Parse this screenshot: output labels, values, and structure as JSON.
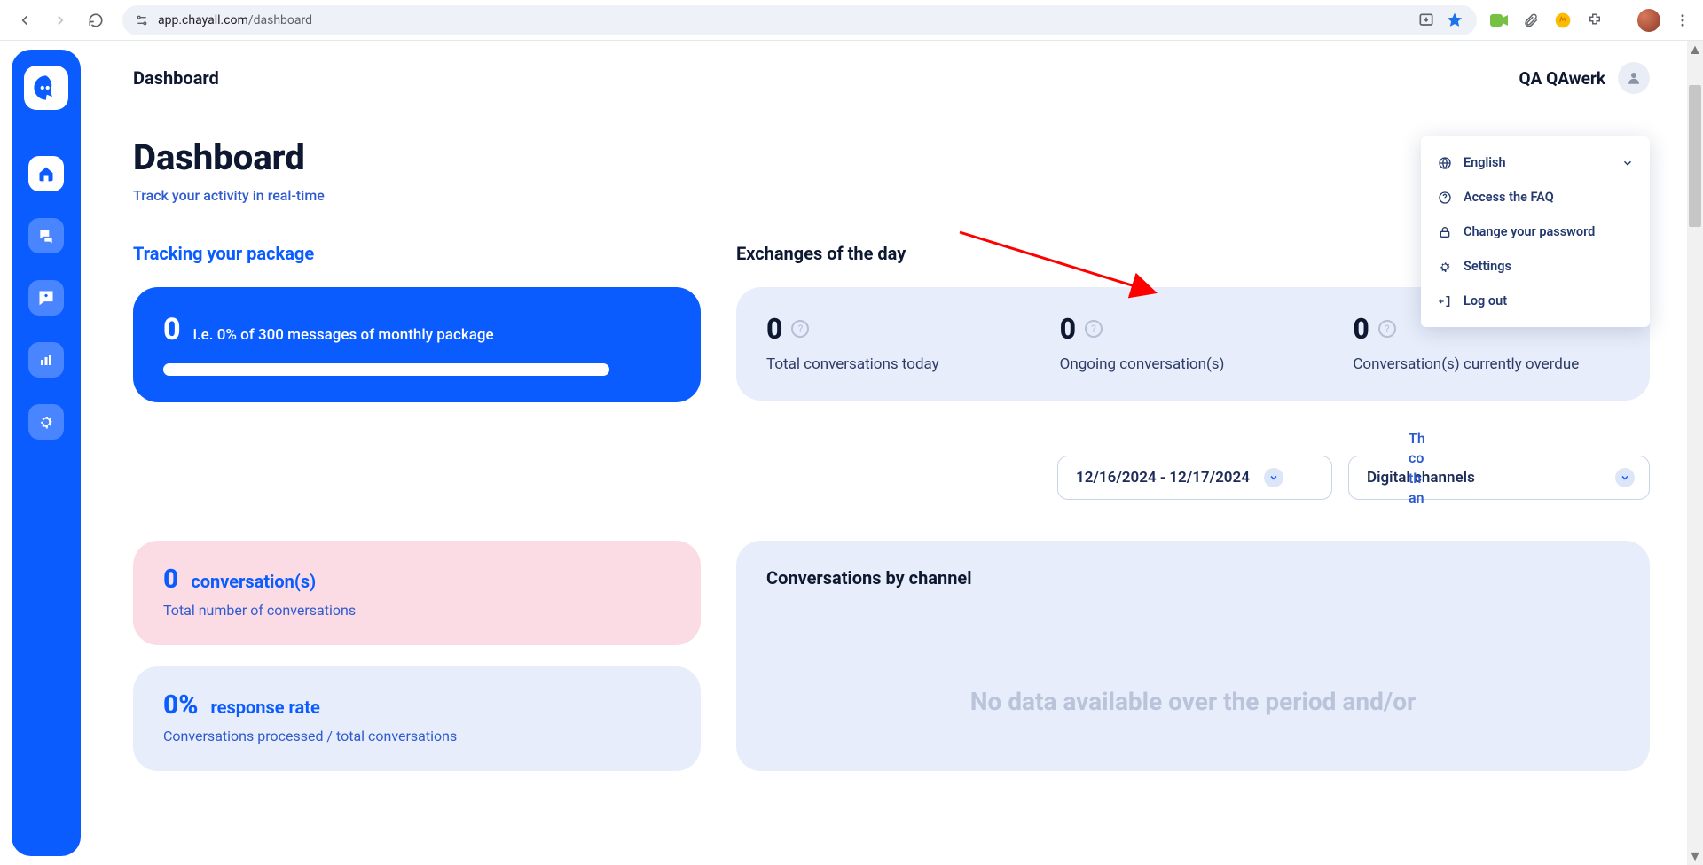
{
  "browser": {
    "url_host": "app.chayall.com",
    "url_path": "/dashboard"
  },
  "header": {
    "breadcrumb": "Dashboard",
    "username": "QA QAwerk"
  },
  "page": {
    "title": "Dashboard",
    "subtitle": "Track your activity in real-time"
  },
  "package": {
    "section_title": "Tracking your package",
    "count": "0",
    "description": "i.e. 0% of 300 messages of monthly package"
  },
  "exchanges": {
    "section_title": "Exchanges of the day",
    "metrics": [
      {
        "value": "0",
        "label": "Total conversations today"
      },
      {
        "value": "0",
        "label": "Ongoing conversation(s)"
      },
      {
        "value": "0",
        "label": "Conversation(s) currently overdue"
      }
    ]
  },
  "filters": {
    "date_range": "12/16/2024 - 12/17/2024",
    "channel": "Digital channels"
  },
  "stats": {
    "conversations": {
      "value": "0",
      "title": "conversation(s)",
      "sub": "Total number of conversations"
    },
    "response_rate": {
      "value": "0%",
      "title": "response rate",
      "sub": "Conversations processed / total conversations"
    }
  },
  "channels": {
    "title": "Conversations by channel",
    "nodata": "No data available over the period and/or"
  },
  "dropdown": {
    "items": [
      {
        "icon": "globe",
        "label": "English",
        "chevron": true
      },
      {
        "icon": "help",
        "label": "Access the FAQ"
      },
      {
        "icon": "lock",
        "label": "Change your password"
      },
      {
        "icon": "gear",
        "label": "Settings"
      },
      {
        "icon": "logout",
        "label": "Log out"
      }
    ]
  },
  "behind_text": "Th\nco\nth\nan"
}
